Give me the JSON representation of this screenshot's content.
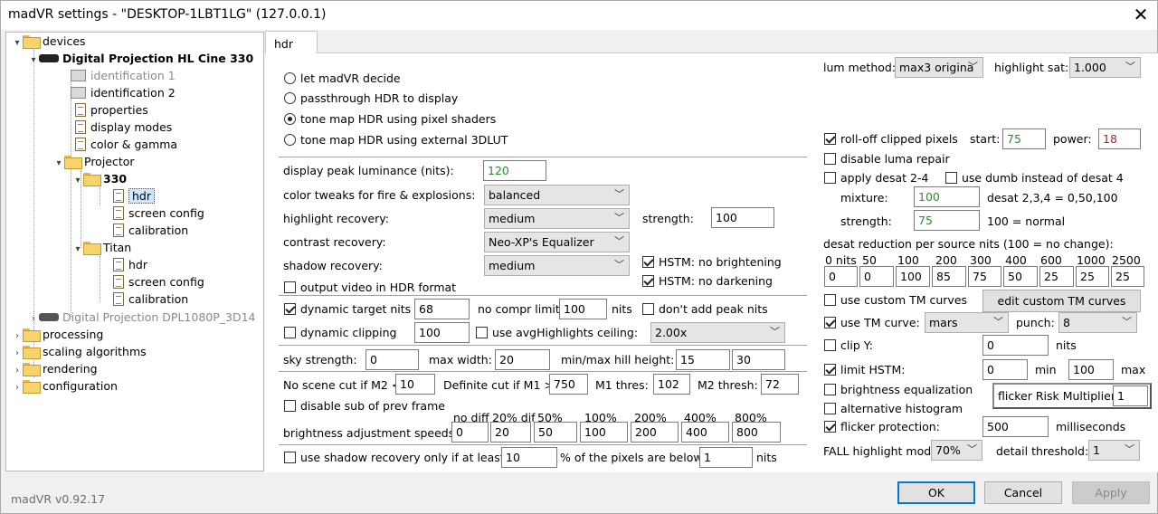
{
  "window": {
    "title": "madVR settings - \"DESKTOP-1LBT1LG\" (127.0.0.1)",
    "close": "✕"
  },
  "tree": {
    "devices": "devices",
    "dev1": "Digital Projection HL Cine 330",
    "id1": "identification 1",
    "id2": "identification 2",
    "properties": "properties",
    "display_modes": "display modes",
    "color_gamma": "color & gamma",
    "projector": "Projector",
    "p330": "330",
    "hdr": "hdr",
    "screen_config": "screen config",
    "calibration": "calibration",
    "titan": "Titan",
    "titan_hdr": "hdr",
    "titan_screen_config": "screen config",
    "titan_calibration": "calibration",
    "dev2": "Digital Projection DPL1080P_3D14",
    "processing": "processing",
    "scaling": "scaling algorithms",
    "rendering": "rendering",
    "configuration": "configuration"
  },
  "tab": {
    "label": "hdr"
  },
  "left": {
    "radios": [
      "let madVR decide",
      "passthrough HDR to display",
      "tone map HDR using pixel shaders",
      "tone map HDR using external 3DLUT"
    ],
    "selected_radio": 2,
    "peak_label": "display peak luminance (nits):",
    "peak_value": "120",
    "color_tweaks_label": "color tweaks for fire & explosions:",
    "color_tweaks_value": "balanced",
    "highlight_rec_label": "highlight recovery:",
    "highlight_rec_value": "medium",
    "strength_label": "strength:",
    "strength_value": "100",
    "contrast_rec_label": "contrast recovery:",
    "contrast_rec_value": "Neo-XP's Equalizer",
    "hstm_nobright": "HSTM: no brightening",
    "shadow_rec_label": "shadow recovery:",
    "shadow_rec_value": "medium",
    "hstm_nodark": "HSTM: no darkening",
    "output_hdr": "output video in HDR format",
    "dyn_target": "dynamic target nits",
    "dyn_target_value": "68",
    "no_compr_label": "no compr limit:",
    "no_compr_value": "100",
    "no_compr_unit": "nits",
    "dont_add_peak": "don't add peak nits",
    "dyn_clip": "dynamic clipping",
    "dyn_clip_value": "100",
    "use_avg": "use avgHighlights ceiling:",
    "avg_value": "2.00x",
    "sky_label": "sky strength:",
    "sky_value": "0",
    "maxw_label": "max width:",
    "maxw_value": "20",
    "hill_label": "min/max hill height:",
    "hill_min": "15",
    "hill_max": "30",
    "noscene_label": "No scene cut if M2 <",
    "noscene_value": "10",
    "defcut_label": "Definite cut if M1 >",
    "defcut_value": "750",
    "m1_label": "M1 thres:",
    "m1_value": "102",
    "m2_label": "M2 thresh:",
    "m2_value": "72",
    "disable_sub": "disable sub of prev frame",
    "speeds_label": "brightness adjustment speeds:",
    "speed_headers": [
      "no diff",
      "20% dif",
      "50%",
      "100%",
      "200%",
      "400%",
      "800%"
    ],
    "speed_values": [
      "0",
      "20",
      "50",
      "100",
      "200",
      "400",
      "800"
    ],
    "shadow_only": "use shadow recovery only if at least:",
    "shadow_only_value": "10",
    "pct_below": "% of the pixels are below",
    "below_value": "1",
    "below_unit": "nits"
  },
  "right": {
    "lum_label": "lum method:",
    "lum_value": "max3 origina",
    "hsat_label": "highlight sat:",
    "hsat_value": "1.000",
    "rolloff": "roll-off clipped pixels",
    "start_label": "start:",
    "start_value": "75",
    "power_label": "power:",
    "power_value": "18",
    "disable_luma": "disable luma repair",
    "apply_desat": "apply desat 2-4",
    "use_dumb": "use dumb instead of desat 4",
    "mixture_label": "mixture:",
    "mixture_value": "100",
    "desat_note": "desat 2,3,4 = 0,50,100",
    "strength_label": "strength:",
    "strength_value": "75",
    "normal_note": "100 = normal",
    "desat_red_label": "desat reduction per source nits (100 = no change):",
    "nits_headers": [
      "0 nits",
      "50",
      "100",
      "200",
      "300",
      "400",
      "600",
      "1000",
      "2500"
    ],
    "nits_values": [
      "0",
      "0",
      "100",
      "85",
      "75",
      "50",
      "25",
      "25",
      "25"
    ],
    "custom_tm": "use custom TM curves",
    "edit_tm": "edit custom TM curves",
    "use_tm": "use TM curve:",
    "tm_value": "mars",
    "punch_label": "punch:",
    "punch_value": "8",
    "clip_y": "clip Y:",
    "clip_y_value": "0",
    "clip_y_unit": "nits",
    "limit_hstm": "limit HSTM:",
    "hstm_min": "0",
    "min_label": "min",
    "hstm_max": "100",
    "max_label": "max",
    "bright_eq": "brightness equalization",
    "flicker_label": "flicker Risk Multiplier:",
    "flicker_value": "1",
    "alt_hist": "alternative histogram",
    "flicker_prot": "flicker protection:",
    "flicker_ms": "500",
    "ms_label": "milliseconds",
    "fall_label": "FALL highlight mod:",
    "fall_value": "70%",
    "detail_label": "detail threshold:",
    "detail_value": "1"
  },
  "footer": {
    "version": "madVR v0.92.17",
    "ok": "OK",
    "cancel": "Cancel",
    "apply": "Apply"
  }
}
